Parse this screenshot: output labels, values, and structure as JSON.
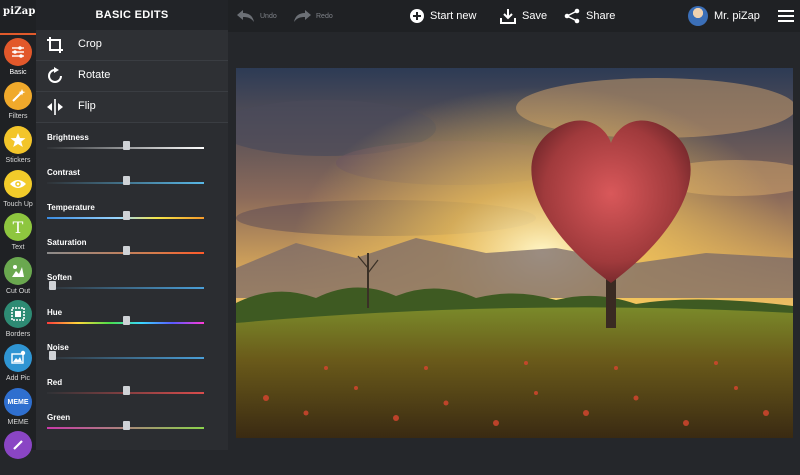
{
  "app": {
    "logo": "piZap"
  },
  "rail": {
    "items": [
      {
        "label": "Basic",
        "color": "#e2582b"
      },
      {
        "label": "Filters",
        "color": "#f0a92b"
      },
      {
        "label": "Stickers",
        "color": "#f3c52a"
      },
      {
        "label": "Touch Up",
        "color": "#f2cb2a"
      },
      {
        "label": "Text",
        "color": "#8ec63f"
      },
      {
        "label": "Cut Out",
        "color": "#6aa84f"
      },
      {
        "label": "Borders",
        "color": "#2e8b74"
      },
      {
        "label": "Add Pic",
        "color": "#2f95d3"
      },
      {
        "label": "MEME",
        "color": "#2f6fcf",
        "inner": "MEME"
      },
      {
        "label": "",
        "color": "#8a45c4"
      }
    ]
  },
  "panel": {
    "title": "BASIC EDITS",
    "tools": [
      {
        "label": "Crop",
        "icon": "crop-icon"
      },
      {
        "label": "Rotate",
        "icon": "rotate-icon"
      },
      {
        "label": "Flip",
        "icon": "flip-icon"
      }
    ],
    "sliders": [
      {
        "label": "Brightness",
        "value": 0.5,
        "color": "#ffffff"
      },
      {
        "label": "Contrast",
        "value": 0.5,
        "color": "#58b7e6"
      },
      {
        "label": "Temperature",
        "value": 0.5,
        "color": "gradient-temp"
      },
      {
        "label": "Saturation",
        "value": 0.5,
        "color": "gradient-sat"
      },
      {
        "label": "Soften",
        "value": 0.0,
        "color": "#4a9fd8"
      },
      {
        "label": "Hue",
        "value": 0.5,
        "color": "gradient-hue"
      },
      {
        "label": "Noise",
        "value": 0.0,
        "color": "#4a9fd8"
      },
      {
        "label": "Red",
        "value": 0.5,
        "color": "#d94c4c"
      },
      {
        "label": "Green",
        "value": 0.5,
        "color": "#8bd24b"
      }
    ]
  },
  "topbar": {
    "undo": "Undo",
    "redo": "Redo",
    "start_new": "Start new",
    "save": "Save",
    "share": "Share",
    "user": "Mr. piZap"
  }
}
